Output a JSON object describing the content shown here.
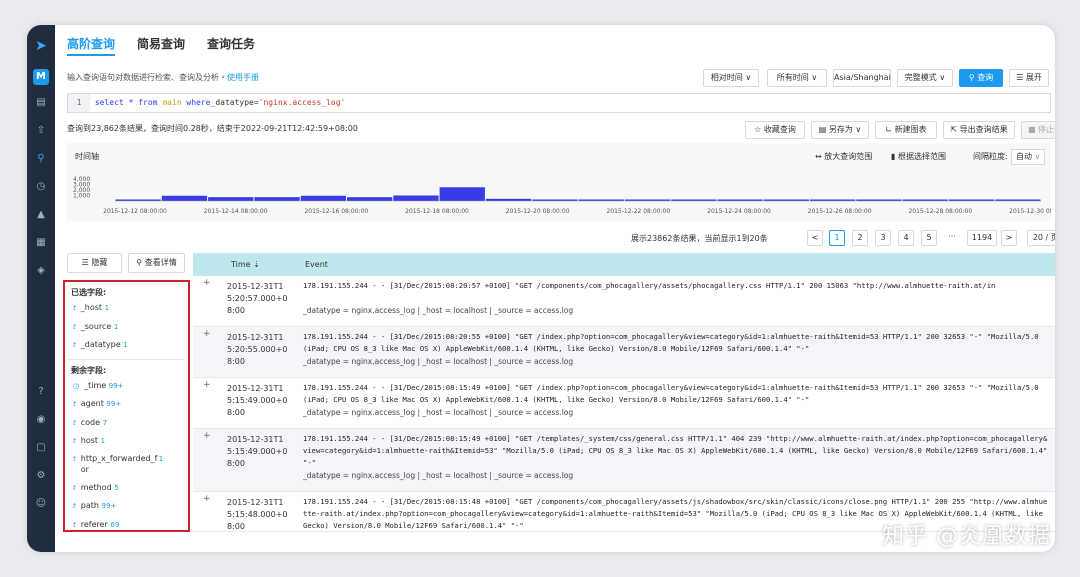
{
  "rail": {
    "badge": "M",
    "icons": [
      "app-logo-icon",
      "workspace-badge",
      "dashboard-icon",
      "upload-icon",
      "search-icon",
      "clock-icon",
      "bell-icon",
      "database-icon",
      "layers-icon",
      "help-icon",
      "location-icon",
      "message-icon",
      "settings-icon",
      "user-icon"
    ]
  },
  "tabs": [
    "高阶查询",
    "简易查询",
    "查询任务"
  ],
  "hint": {
    "text": "输入查询语句对数据进行检索、查询及分析・",
    "link": "使用手册"
  },
  "toolbar": {
    "relative_time": "相对时间 ∨",
    "all_time": "所有时间 ∨",
    "timezone": "Asia/Shanghai",
    "mode": "完整模式 ∨",
    "query": "查询",
    "expand": "展开"
  },
  "query": {
    "line": "1",
    "select": "select",
    "star": "*",
    "from": "from",
    "table": "main",
    "where": "where",
    "field": "_datatype=",
    "value": "'nginx.access_log'"
  },
  "status": "查询到23,862条结果，查询时间0.28秒，结束于2022-09-21T12:42:59+08:00",
  "actions": {
    "save_query": "收藏查询",
    "save_as": "另存为 ∨",
    "new_chart": "新建图表",
    "export": "导出查询结果",
    "stop": "停止查询"
  },
  "histogram": {
    "label": "时间轴",
    "zoom": "放大查询范围",
    "select_range": "根据选择范围",
    "granularity_label": "间隔粒度:",
    "granularity": "自动",
    "y_ticks": [
      "4,000",
      "3,000",
      "2,000",
      "1,000"
    ],
    "x_ticks": [
      "2015-12-12 08:00:00",
      "2015-12-14 08:00:00",
      "2015-12-16 08:00:00",
      "2015-12-18 08:00:00",
      "2015-12-20 08:00:00",
      "2015-12-22 08:00:00",
      "2015-12-24 08:00:00",
      "2015-12-26 08:00:00",
      "2015-12-28 08:00:00",
      "2015-12-30 08:00:00"
    ],
    "bars": [
      100,
      950,
      700,
      700,
      950,
      700,
      1000,
      2500,
      400,
      100,
      100,
      100,
      100,
      100,
      100,
      100,
      100,
      100,
      200,
      100
    ]
  },
  "pagination": {
    "info": "展示23862条结果，当前显示1到20条",
    "prev": "<",
    "pages": [
      "1",
      "2",
      "3",
      "4",
      "5"
    ],
    "ellipsis": "···",
    "last": "1194",
    "next": ">",
    "page_size": "20 / 页 ∨"
  },
  "field_buttons": {
    "hide": "隐藏",
    "details": "查看详情"
  },
  "fields": {
    "selected_title": "已选字段:",
    "selected": [
      {
        "type": "t",
        "name": "_host",
        "count": "1"
      },
      {
        "type": "t",
        "name": "_source",
        "count": "1"
      },
      {
        "type": "t",
        "name": "_datatype",
        "count": "1"
      }
    ],
    "other_title": "剩余字段:",
    "other": [
      {
        "type": "◷",
        "name": "_time",
        "count": "99+"
      },
      {
        "type": "t",
        "name": "agent",
        "count": "99+"
      },
      {
        "type": "t",
        "name": "code",
        "count": "7"
      },
      {
        "type": "t",
        "name": "host",
        "count": "1"
      },
      {
        "type": "t",
        "name": "http_x_forwarded_f or",
        "count": "1"
      },
      {
        "type": "t",
        "name": "method",
        "count": "5"
      },
      {
        "type": "t",
        "name": "path",
        "count": "99+"
      },
      {
        "type": "t",
        "name": "referer",
        "count": "69"
      }
    ]
  },
  "table": {
    "col_time": "Time ⇣",
    "col_event": "Event",
    "rows": [
      {
        "expand": "+",
        "time": "2015-12-31T15:20:57.000+08:00",
        "event": "178.191.155.244 - - [31/Dec/2015:08:20:57 +0100] \"GET /components/com_phocagallery/assets/phocagallery.css HTTP/1.1\" 200 15063 \"http://www.almhuette-raith.at/in",
        "meta": "_datatype = nginx.access_log | _host = localhost | _source = access.log"
      },
      {
        "expand": "+",
        "time": "2015-12-31T15:20:55.000+08:00",
        "event": "178.191.155.244 - - [31/Dec/2015:08:20:55 +0100] \"GET /index.php?option=com_phocagallery&view=category&id=1:almhuette-raith&Itemid=53 HTTP/1.1\" 200 32653 \"-\" \"Mozilla/5.0 (iPad; CPU OS 8_3 like Mac OS X) AppleWebKit/600.1.4 (KHTML, like Gecko) Version/8.0 Mobile/12F69 Safari/600.1.4\" \"-\"",
        "meta": "_datatype = nginx.access_log | _host = localhost | _source = access.log"
      },
      {
        "expand": "+",
        "time": "2015-12-31T15:15:49.000+08:00",
        "event": "178.191.155.244 - - [31/Dec/2015:08:15:49 +0100] \"GET /index.php?option=com_phocagallery&view=category&id=1:almhuette-raith&Itemid=53 HTTP/1.1\" 200 32653 \"-\" \"Mozilla/5.0 (iPad; CPU OS 8_3 like Mac OS X) AppleWebKit/600.1.4 (KHTML, like Gecko) Version/8.0 Mobile/12F69 Safari/600.1.4\" \"-\"",
        "meta": "_datatype = nginx.access_log | _host = localhost | _source = access.log"
      },
      {
        "expand": "+",
        "time": "2015-12-31T15:15:49.000+08:00",
        "event": "178.191.155.244 - - [31/Dec/2015:08:15:49 +0100] \"GET /templates/_system/css/general.css HTTP/1.1\" 404 239 \"http://www.almhuette-raith.at/index.php?option=com_phocagallery&view=category&id=1:almhuette-raith&Itemid=53\" \"Mozilla/5.0 (iPad; CPU OS 8_3 like Mac OS X) AppleWebKit/600.1.4 (KHTML, like Gecko) Version/8.0 Mobile/12F69 Safari/600.1.4\" \"-\"",
        "meta": "_datatype = nginx.access_log | _host = localhost | _source = access.log"
      },
      {
        "expand": "+",
        "time": "2015-12-31T15:15:48.000+08:00",
        "event": "178.191.155.244 - - [31/Dec/2015:08:15:48 +0100] \"GET /components/com_phocagallery/assets/js/shadowbox/src/skin/classic/icons/close.png HTTP/1.1\" 200 255 \"http://www.almhuette-raith.at/index.php?option=com_phocagallery&view=category&id=1:almhuette-raith&Itemid=53\" \"Mozilla/5.0 (iPad; CPU OS 8_3 like Mac OS X) AppleWebKit/600.1.4 (KHTML, like Gecko) Version/8.0 Mobile/12F69 Safari/600.1.4\" \"-\"",
        "meta": ""
      }
    ]
  },
  "watermark": "知乎 @炎凰数据",
  "colors": {
    "accent": "#1b9aee",
    "rail": "#1f2d3f",
    "bar": "#3a3de6",
    "highlight": "#d0202a",
    "header": "#bfe8ee"
  }
}
